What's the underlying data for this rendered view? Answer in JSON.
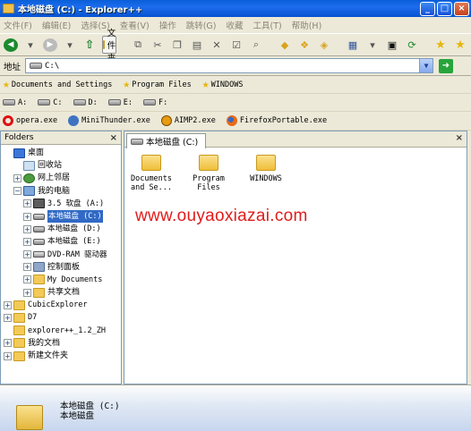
{
  "window": {
    "title": "本地磁盘 (C:) - Explorer++"
  },
  "menu": [
    "文件(F)",
    "编辑(E)",
    "选择(S)",
    "查看(V)",
    "操作",
    "跳转(G)",
    "收藏",
    "工具(T)",
    "帮助(H)"
  ],
  "toolbar": {
    "folders_label": "文件夹"
  },
  "address": {
    "label": "地址",
    "value": "C:\\"
  },
  "bookmarks": [
    "Documents and Settings",
    "Program Files",
    "WINDOWS"
  ],
  "drives": [
    "A:",
    "C:",
    "D:",
    "E:",
    "F:"
  ],
  "apps": [
    "opera.exe",
    "MiniThunder.exe",
    "AIMP2.exe",
    "FirefoxPortable.exe"
  ],
  "folders_pane": {
    "title": "Folders",
    "close": "×"
  },
  "tree": [
    {
      "label": "桌面",
      "icon": "desktop-icon",
      "indent": 0,
      "toggle": "",
      "mono": false
    },
    {
      "label": "回收站",
      "icon": "recycle-bin-icon",
      "indent": 1,
      "toggle": "",
      "mono": false
    },
    {
      "label": "网上邻居",
      "icon": "network-icon",
      "indent": 1,
      "toggle": "+",
      "mono": false
    },
    {
      "label": "我的电脑",
      "icon": "computer-icon",
      "indent": 1,
      "toggle": "-",
      "mono": false
    },
    {
      "label": "3.5 软盘 (A:)",
      "icon": "floppy-icon",
      "indent": 2,
      "toggle": "+",
      "mono": true
    },
    {
      "label": "本地磁盘 (C:)",
      "icon": "drive-icon",
      "indent": 2,
      "toggle": "+",
      "mono": true,
      "selected": true
    },
    {
      "label": "本地磁盘 (D:)",
      "icon": "drive-icon",
      "indent": 2,
      "toggle": "+",
      "mono": true
    },
    {
      "label": "本地磁盘 (E:)",
      "icon": "drive-icon",
      "indent": 2,
      "toggle": "+",
      "mono": true
    },
    {
      "label": "DVD-RAM 驱动器",
      "icon": "dvd-icon",
      "indent": 2,
      "toggle": "+",
      "mono": true
    },
    {
      "label": "控制面板",
      "icon": "control-panel-icon",
      "indent": 2,
      "toggle": "+",
      "mono": false
    },
    {
      "label": "My Documents",
      "icon": "folder-icon",
      "indent": 2,
      "toggle": "+",
      "mono": true
    },
    {
      "label": "共享文档",
      "icon": "folder-icon",
      "indent": 2,
      "toggle": "+",
      "mono": false
    },
    {
      "label": "CubicExplorer",
      "icon": "folder-icon",
      "indent": 0,
      "toggle": "+",
      "mono": true
    },
    {
      "label": "D7",
      "icon": "folder-icon",
      "indent": 0,
      "toggle": "+",
      "mono": true
    },
    {
      "label": "explorer++_1.2_ZH",
      "icon": "folder-icon",
      "indent": 0,
      "toggle": "",
      "mono": true
    },
    {
      "label": "我的文档",
      "icon": "folder-icon",
      "indent": 0,
      "toggle": "+",
      "mono": false
    },
    {
      "label": "新建文件夹",
      "icon": "folder-icon",
      "indent": 0,
      "toggle": "+",
      "mono": false
    }
  ],
  "tab": {
    "label": "本地磁盘 (C:)",
    "close": "×"
  },
  "files": [
    {
      "line1": "Documents",
      "line2": "and Se..."
    },
    {
      "line1": "Program",
      "line2": "Files"
    },
    {
      "line1": "WINDOWS",
      "line2": ""
    }
  ],
  "watermark": "www.ouyaoxiazai.com",
  "status": {
    "name": "本地磁盘 (C:)",
    "type": "本地磁盘"
  }
}
